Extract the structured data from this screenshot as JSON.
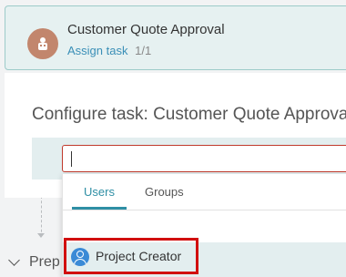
{
  "step": {
    "title": "Customer Quote Approval",
    "assign_link": "Assign task",
    "count": "1/1",
    "icon": "user-group-icon"
  },
  "configure": {
    "title": "Configure task: Customer Quote Approval"
  },
  "search": {
    "value": "",
    "placeholder": ""
  },
  "tabs": [
    {
      "label": "Users",
      "active": true
    },
    {
      "label": "Groups",
      "active": false
    }
  ],
  "results": [
    {
      "label": "Project Creator",
      "icon": "user-icon"
    }
  ],
  "section": {
    "label": "Prep"
  },
  "colors": {
    "accent": "#2f8fa5",
    "link": "#3a8fb7",
    "avatar": "#c2866d",
    "highlight_border": "#d10f0f",
    "input_border": "#c0392b",
    "user_icon": "#3a8ad6"
  }
}
